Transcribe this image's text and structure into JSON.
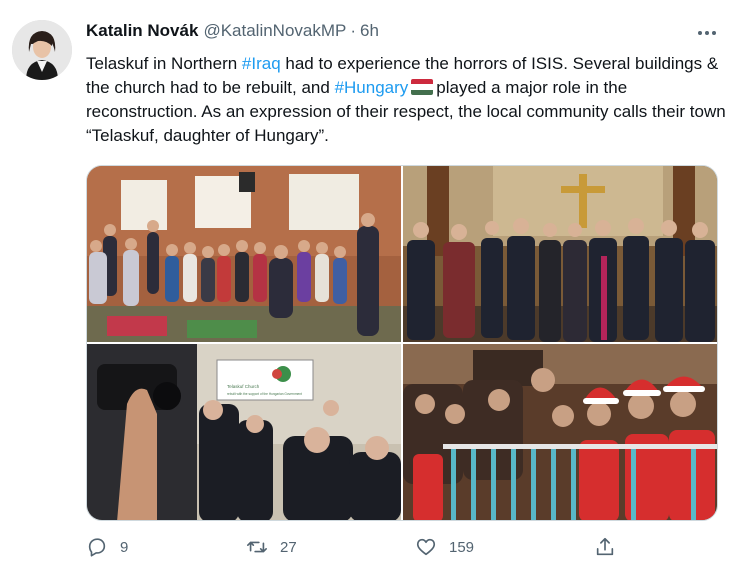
{
  "tweet": {
    "author_name": "Katalin Novák",
    "handle": "@KatalinNovakMP",
    "separator": "·",
    "time": "6h",
    "text": {
      "part1": "Telaskuf in Northern ",
      "hashtag1": "#Iraq",
      "part2": " had to experience the horrors of ISIS. Several buildings & the church had to be rebuilt, and ",
      "hashtag2": "#Hungary",
      "part3": "played a major role in the reconstruction. As an expression of their respect, the local community calls their town “Telaskuf, daughter of Hungary”."
    },
    "flag_colors": [
      "#cd2a3e",
      "#ffffff",
      "#436f4d"
    ],
    "photos": [
      "children-group-photo",
      "church-delegation-photo",
      "plaque-unveiling-photo",
      "children-santa-hats-photo"
    ],
    "photo_plaque_text": {
      "line1": "Telaskuf Church",
      "line2": "rebuilt with the support of the Hungarian Government"
    }
  },
  "actions": {
    "reply_count": "9",
    "retweet_count": "27",
    "like_count": "159",
    "reply_icon": "reply-icon",
    "retweet_icon": "retweet-icon",
    "like_icon": "heart-icon",
    "share_icon": "share-icon"
  },
  "colors": {
    "link": "#1d9bf0",
    "text": "#0f1419",
    "secondary": "#536471",
    "border": "#cfd9de"
  }
}
